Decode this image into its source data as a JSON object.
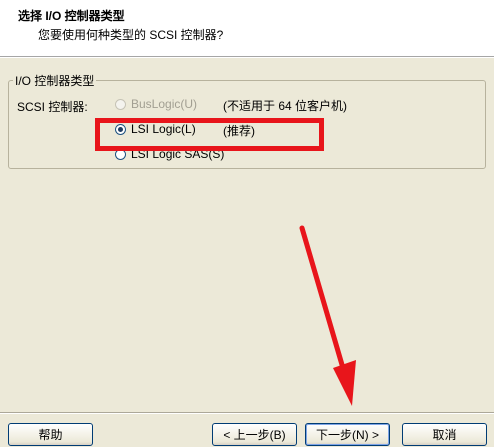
{
  "header": {
    "title": "选择 I/O 控制器类型",
    "subtitle": "您要使用何种类型的 SCSI 控制器?"
  },
  "group": {
    "legend": "I/O 控制器类型",
    "scsi_label": "SCSI 控制器:",
    "options": [
      {
        "label": "BusLogic(U)",
        "note": "(不适用于 64 位客户机)",
        "checked": false,
        "enabled": false
      },
      {
        "label": "LSI Logic(L)",
        "note": "(推荐)",
        "checked": true,
        "enabled": true
      },
      {
        "label": "LSI Logic SAS(S)",
        "note": "",
        "checked": false,
        "enabled": true
      }
    ]
  },
  "buttons": {
    "help": "帮助",
    "back": "< 上一步(B)",
    "next": "下一步(N) >",
    "cancel": "取消"
  },
  "annotation_color": "#e8151b"
}
